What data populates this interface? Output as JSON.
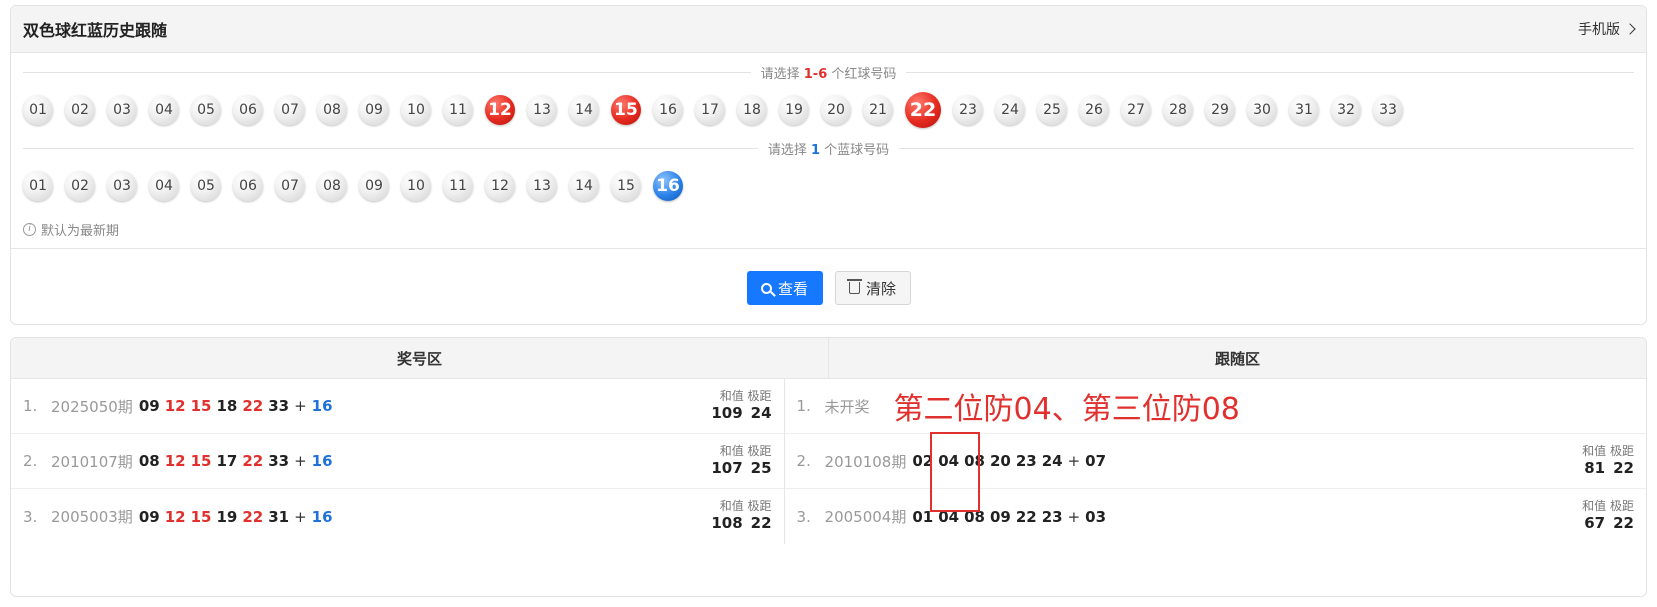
{
  "header": {
    "title": "双色球红蓝历史跟随",
    "mobile_label": "手机版"
  },
  "red_section": {
    "prefix": "请选择 ",
    "range": "1-6",
    "suffix": " 个红球号码",
    "balls": [
      "01",
      "02",
      "03",
      "04",
      "05",
      "06",
      "07",
      "08",
      "09",
      "10",
      "11",
      "12",
      "13",
      "14",
      "15",
      "16",
      "17",
      "18",
      "19",
      "20",
      "21",
      "22",
      "23",
      "24",
      "25",
      "26",
      "27",
      "28",
      "29",
      "30",
      "31",
      "32",
      "33"
    ],
    "selected": [
      "12",
      "15",
      "22"
    ]
  },
  "blue_section": {
    "prefix": "请选择 ",
    "count": "1",
    "suffix": " 个蓝球号码",
    "balls": [
      "01",
      "02",
      "03",
      "04",
      "05",
      "06",
      "07",
      "08",
      "09",
      "10",
      "11",
      "12",
      "13",
      "14",
      "15",
      "16"
    ],
    "selected": [
      "16"
    ]
  },
  "note": "默认为最新期",
  "buttons": {
    "search": "查看",
    "clear": "清除"
  },
  "table": {
    "left_header": "奖号区",
    "right_header": "跟随区",
    "sum_label": "和值",
    "span_label": "极距",
    "left_rows": [
      {
        "idx": "1.",
        "period": "2025050期",
        "nums": [
          "09",
          "12",
          "15",
          "18",
          "22",
          "33"
        ],
        "blue": "16",
        "sum": "109",
        "span": "24"
      },
      {
        "idx": "2.",
        "period": "2010107期",
        "nums": [
          "08",
          "12",
          "15",
          "17",
          "22",
          "33"
        ],
        "blue": "16",
        "sum": "107",
        "span": "25"
      },
      {
        "idx": "3.",
        "period": "2005003期",
        "nums": [
          "09",
          "12",
          "15",
          "19",
          "22",
          "31"
        ],
        "blue": "16",
        "sum": "108",
        "span": "22"
      }
    ],
    "right_rows": [
      {
        "idx": "1.",
        "status": "未开奖",
        "annotation": "第二位防04、第三位防08"
      },
      {
        "idx": "2.",
        "period": "2010108期",
        "nums": [
          "02",
          "04",
          "08",
          "20",
          "23",
          "24"
        ],
        "blue": "07",
        "sum": "81",
        "span": "22"
      },
      {
        "idx": "3.",
        "period": "2005004期",
        "nums": [
          "01",
          "04",
          "08",
          "09",
          "22",
          "23"
        ],
        "blue": "03",
        "sum": "67",
        "span": "22"
      }
    ]
  },
  "colors": {
    "red": "#e0312e",
    "blue": "#1e72d9",
    "primary": "#1677ff"
  }
}
